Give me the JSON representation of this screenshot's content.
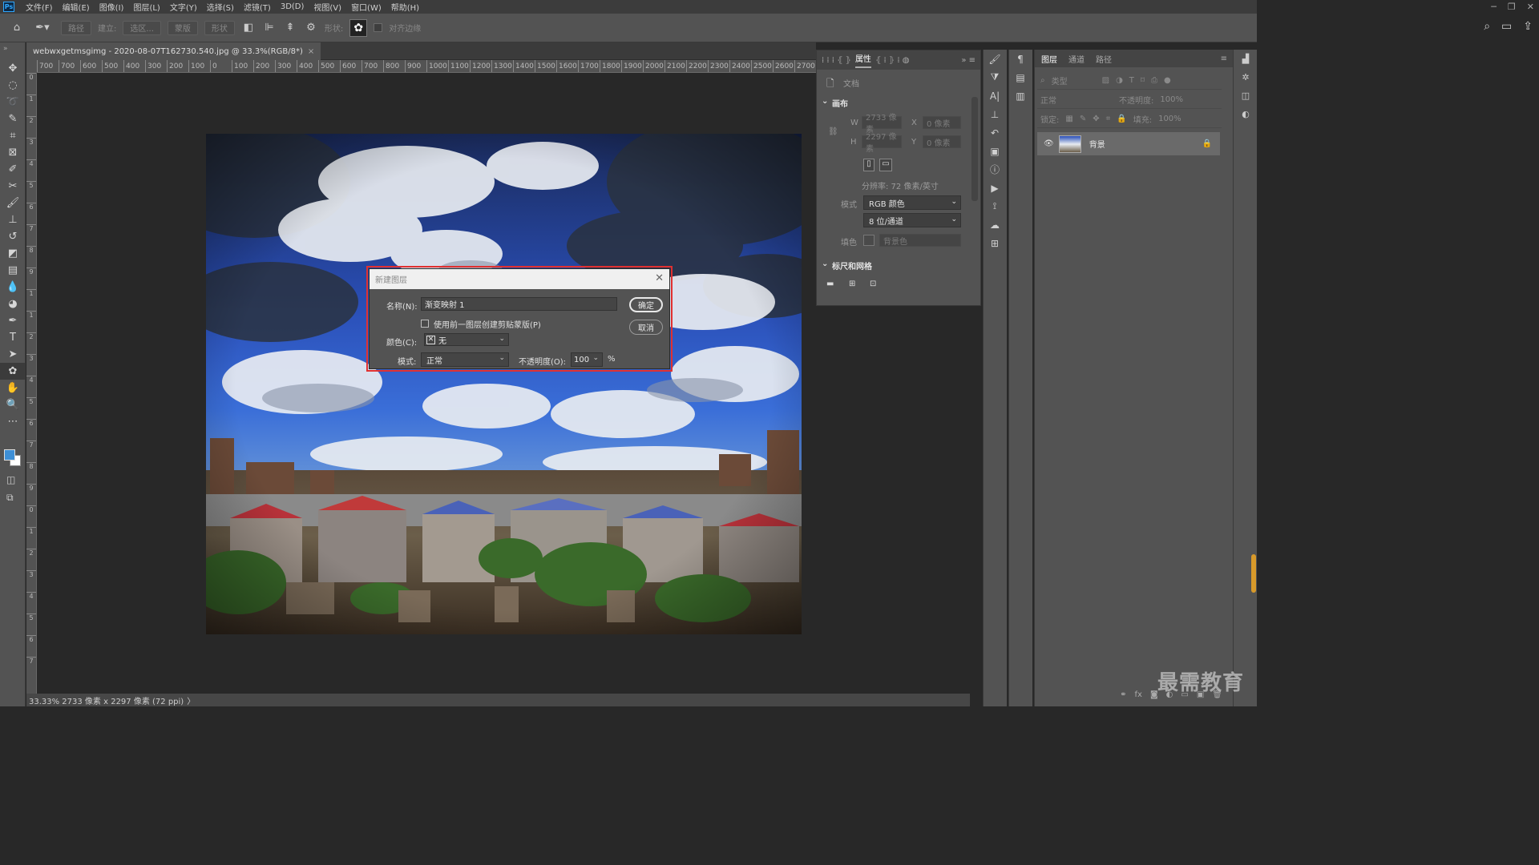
{
  "menu": {
    "logo": "Ps",
    "items": [
      "文件(F)",
      "编辑(E)",
      "图像(I)",
      "图层(L)",
      "文字(Y)",
      "选择(S)",
      "滤镜(T)",
      "3D(D)",
      "视图(V)",
      "窗口(W)",
      "帮助(H)"
    ],
    "window_controls": [
      "─",
      "❐",
      "✕"
    ]
  },
  "options": {
    "path_btn": "路径",
    "make_label": "建立:",
    "selection_btn": "选区...",
    "mask_btn": "蒙版",
    "shape_btn": "形状",
    "shape_label": "形状:",
    "align_edges": "对齐边缘"
  },
  "document": {
    "tab_title": "webwxgetmsgimg - 2020-08-07T162730.540.jpg @ 33.3%(RGB/8*)",
    "tab_close": "×",
    "ruler_h": [
      "700",
      "700",
      "600",
      "500",
      "400",
      "300",
      "200",
      "100",
      "0",
      "100",
      "200",
      "300",
      "400",
      "500",
      "600",
      "700",
      "800",
      "900",
      "1000",
      "1100",
      "1200",
      "1300",
      "1400",
      "1500",
      "1600",
      "1700",
      "1800",
      "1900",
      "2000",
      "2100",
      "2200",
      "2300",
      "2400",
      "2500",
      "2600",
      "2700"
    ],
    "ruler_v": [
      "0",
      "1",
      "2",
      "3",
      "4",
      "5",
      "6",
      "7",
      "8",
      "9",
      "1",
      "1",
      "2",
      "3",
      "4",
      "5",
      "6",
      "7",
      "8",
      "9",
      "0",
      "1",
      "2",
      "3",
      "4",
      "5",
      "6",
      "7"
    ],
    "status": "33.33%  2733 像素 x 2297 像素 (72 ppi)",
    "status_arrow": "〉"
  },
  "dialog": {
    "title": "新建图层",
    "close": "✕",
    "name_label": "名称(N):",
    "name_value": "渐变映射 1",
    "ok": "确定",
    "cancel": "取消",
    "clip_label": "使用前一图层创建剪贴蒙版(P)",
    "color_label": "颜色(C):",
    "color_value": "无",
    "mode_label": "模式:",
    "mode_value": "正常",
    "opacity_label": "不透明度(O):",
    "opacity_value": "100",
    "percent": "%"
  },
  "properties": {
    "tab_active": "属性",
    "doc_label": "文档",
    "canvas_section": "画布",
    "w_label": "W",
    "w_value": "2733 像素",
    "h_label": "H",
    "h_value": "2297 像素",
    "x_label": "X",
    "x_value": "0 像素",
    "y_label": "Y",
    "y_value": "0 像素",
    "resolution": "分辨率: 72 像素/英寸",
    "mode_label": "模式",
    "mode_value": "RGB 颜色",
    "depth_value": "8 位/通道",
    "fill_label": "填色",
    "fill_value": "背景色",
    "rulers_section": "标尺和网格"
  },
  "layers": {
    "tabs": [
      "图层",
      "通道",
      "路径"
    ],
    "filter_placeholder": "类型",
    "blend_mode": "正常",
    "opacity_label": "不透明度:",
    "opacity_value": "100%",
    "lock_label": "锁定:",
    "fill_label": "填充:",
    "fill_value": "100%",
    "layer_name": "背景",
    "bottom_icons": [
      "⚭",
      "fx",
      "◙",
      "◐",
      "▭",
      "▣",
      "🗑"
    ]
  },
  "watermark": "最需教育",
  "colors": {
    "foreground": "#3d8fd6",
    "background": "#ffffff",
    "dialog_highlight": "#e03030"
  }
}
